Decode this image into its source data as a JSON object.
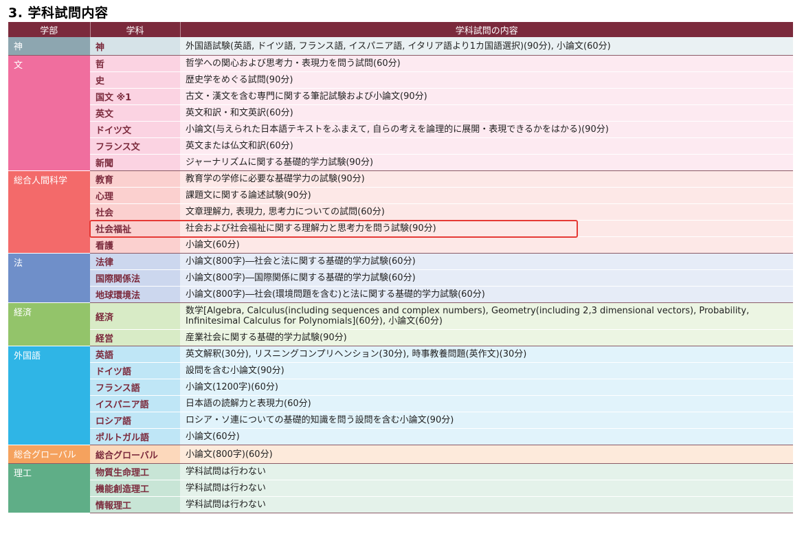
{
  "title": "3. 学科試問内容",
  "headers": {
    "faculty": "学部",
    "department": "学科",
    "content": "学科試問の内容"
  },
  "colors": {
    "header": "#7b2a3c",
    "highlight": "#e53935"
  },
  "groups": [
    {
      "faculty": "神",
      "fac_bg": "#8da6b0",
      "dep_bg": "#d6e3e8",
      "row_bg": "#eaf1f3",
      "rows": [
        {
          "dept": "神",
          "content": "外国語試験(英語, ドイツ語, フランス語, イスパニア語, イタリア語より1カ国語選択)(90分), 小論文(60分)"
        }
      ]
    },
    {
      "faculty": "文",
      "fac_bg": "#f06e9e",
      "dep_bg": "#fbd3e2",
      "row_bg": "#fdeaf1",
      "rows": [
        {
          "dept": "哲",
          "content": "哲学への関心および思考力・表現力を問う試問(60分)"
        },
        {
          "dept": "史",
          "content": "歴史学をめぐる試問(90分)"
        },
        {
          "dept": "国文 ※1",
          "content": "古文・漢文を含む専門に関する筆記試験および小論文(90分)"
        },
        {
          "dept": "英文",
          "content": "英文和訳・和文英訳(60分)"
        },
        {
          "dept": "ドイツ文",
          "content": "小論文(与えられた日本語テキストをふまえて, 自らの考えを論理的に展開・表現できるかをはかる)(90分)"
        },
        {
          "dept": "フランス文",
          "content": "英文または仏文和訳(60分)"
        },
        {
          "dept": "新聞",
          "content": "ジャーナリズムに関する基礎的学力試験(90分)"
        }
      ]
    },
    {
      "faculty": "総合人間科学",
      "fac_bg": "#f36a6a",
      "dep_bg": "#fbd0cf",
      "row_bg": "#fde8e7",
      "rows": [
        {
          "dept": "教育",
          "content": "教育学の学修に必要な基礎学力の試験(90分)"
        },
        {
          "dept": "心理",
          "content": "課題文に関する論述試験(90分)"
        },
        {
          "dept": "社会",
          "content": "文章理解力, 表現力, 思考力についての試問(60分)"
        },
        {
          "dept": "社会福祉",
          "content": "社会および社会福祉に関する理解力と思考力を問う試験(90分)"
        },
        {
          "dept": "看護",
          "content": "小論文(60分)"
        }
      ]
    },
    {
      "faculty": "法",
      "fac_bg": "#6f8fc9",
      "dep_bg": "#ccd7ee",
      "row_bg": "#e6ecf7",
      "rows": [
        {
          "dept": "法律",
          "content": "小論文(800字)―社会と法に関する基礎的学力試験(60分)"
        },
        {
          "dept": "国際関係法",
          "content": "小論文(800字)―国際関係に関する基礎的学力試験(60分)"
        },
        {
          "dept": "地球環境法",
          "content": "小論文(800字)―社会(環境問題を含む)と法に関する基礎的学力試験(60分)"
        }
      ]
    },
    {
      "faculty": "経済",
      "fac_bg": "#93c46a",
      "dep_bg": "#d8ebc6",
      "row_bg": "#ecf5e3",
      "rows": [
        {
          "dept": "経済",
          "tall": true,
          "content": "数学[Algebra, Calculus(including sequences and complex numbers), Geometry(including 2,3 dimensional vectors), Probability, Infinitesimal Calculus for Polynomials](60分), 小論文(60分)"
        },
        {
          "dept": "経営",
          "content": "産業社会に関する基礎的学力試験(90分)"
        }
      ]
    },
    {
      "faculty": "外国語",
      "fac_bg": "#2fb5e6",
      "dep_bg": "#bfe6f6",
      "row_bg": "#e1f3fb",
      "rows": [
        {
          "dept": "英語",
          "content": "英文解釈(30分), リスニングコンプリヘンション(30分), 時事教養問題(英作文)(30分)"
        },
        {
          "dept": "ドイツ語",
          "content": "設問を含む小論文(90分)"
        },
        {
          "dept": "フランス語",
          "content": "小論文(1200字)(60分)"
        },
        {
          "dept": "イスパニア語",
          "content": "日本語の読解力と表現力(60分)"
        },
        {
          "dept": "ロシア語",
          "content": "ロシア・ソ連についての基礎的知識を問う設問を含む小論文(90分)"
        },
        {
          "dept": "ポルトガル語",
          "content": "小論文(60分)"
        }
      ]
    },
    {
      "faculty": "総合グローバル",
      "fac_bg": "#f5a25e",
      "dep_bg": "#fcd8bb",
      "row_bg": "#fdeadb",
      "rows": [
        {
          "dept": "総合グローバル",
          "content": "小論文(800字)(60分)"
        }
      ]
    },
    {
      "faculty": "理工",
      "fac_bg": "#5fae87",
      "dep_bg": "#c8e5d6",
      "row_bg": "#e4f2ea",
      "rows": [
        {
          "dept": "物質生命理工",
          "content": "学科試問は行わない"
        },
        {
          "dept": "機能創造理工",
          "content": "学科試問は行わない"
        },
        {
          "dept": "情報理工",
          "content": "学科試問は行わない"
        }
      ]
    }
  ]
}
